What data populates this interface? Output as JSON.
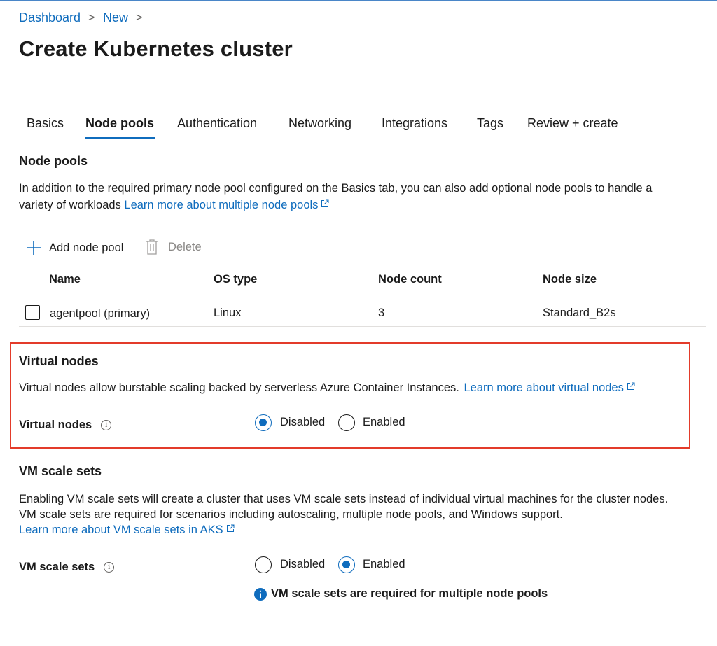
{
  "breadcrumb": {
    "items": [
      "Dashboard",
      "New"
    ],
    "separator": ">"
  },
  "page": {
    "title": "Create Kubernetes cluster"
  },
  "tabs": [
    {
      "label": "Basics",
      "active": false
    },
    {
      "label": "Node pools",
      "active": true
    },
    {
      "label": "Authentication",
      "active": false
    },
    {
      "label": "Networking",
      "active": false
    },
    {
      "label": "Integrations",
      "active": false
    },
    {
      "label": "Tags",
      "active": false
    },
    {
      "label": "Review + create",
      "active": false
    }
  ],
  "node_pools": {
    "heading": "Node pools",
    "description_line1": "In addition to the required primary node pool configured on the Basics tab, you can also add optional node pools to handle a",
    "description_line2": "variety of workloads",
    "learn_more": "Learn more about multiple node pools",
    "toolbar": {
      "add_label": "Add node pool",
      "delete_label": "Delete",
      "add_icon": "plus-icon",
      "delete_icon": "trash-icon"
    },
    "table": {
      "columns": [
        "Name",
        "OS type",
        "Node count",
        "Node size"
      ],
      "rows": [
        {
          "name": "agentpool (primary)",
          "os_type": "Linux",
          "node_count": "3",
          "node_size": "Standard_B2s"
        }
      ]
    }
  },
  "virtual_nodes": {
    "heading": "Virtual nodes",
    "description": "Virtual nodes allow burstable scaling backed by serverless Azure Container Instances.",
    "learn_more": "Learn more about virtual nodes",
    "field_label": "Virtual nodes",
    "options": [
      "Disabled",
      "Enabled"
    ],
    "selected": "Disabled"
  },
  "vm_scale_sets": {
    "heading": "VM scale sets",
    "description_line1": "Enabling VM scale sets will create a cluster that uses VM scale sets instead of individual virtual machines for the cluster nodes.",
    "description_line2": "VM scale sets are required for scenarios including autoscaling, multiple node pools, and Windows support.",
    "learn_more": "Learn more about VM scale sets in AKS",
    "field_label": "VM scale sets",
    "options": [
      "Disabled",
      "Enabled"
    ],
    "selected": "Enabled",
    "info_message": "VM scale sets are required for multiple node pools"
  },
  "colors": {
    "accent": "#0f6cbd",
    "highlight_border": "#e33b2a",
    "text": "#1b1b1b",
    "muted": "#8a8886"
  }
}
